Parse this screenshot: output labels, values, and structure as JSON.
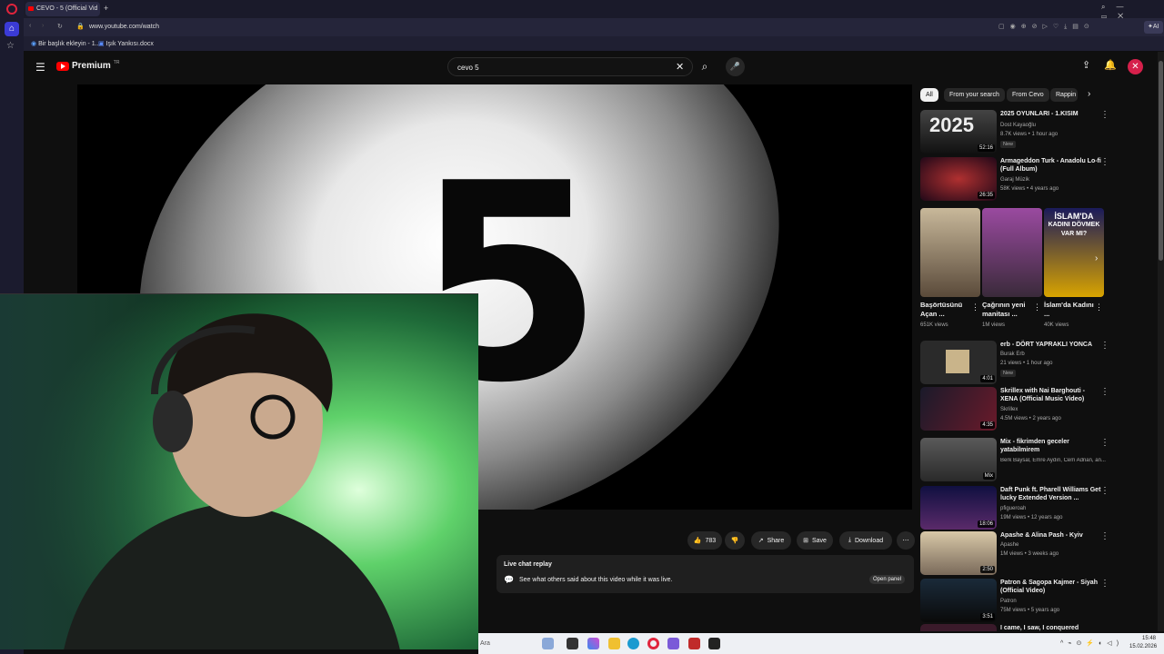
{
  "browser": {
    "tab_title": "CEVO - 5 (Official Vid",
    "url": "www.youtube.com/watch",
    "bookmarks": [
      "Bir başlık ekleyin - 1...",
      "Işık Yankısı.docx"
    ],
    "ai_label": "AI"
  },
  "youtube": {
    "logo": "Premium",
    "logo_sup": "TR",
    "search_value": "cevo 5",
    "video_digit": "5",
    "likes": "783",
    "share_label": "Share",
    "save_label": "Save",
    "download_label": "Download",
    "live_chat_title": "Live chat replay",
    "live_chat_desc": "See what others said about this video while it was live.",
    "open_panel_label": "Open panel",
    "chips": [
      "All",
      "From your search",
      "From Cevo",
      "Rappin"
    ]
  },
  "recommendations": [
    {
      "title": "2025 OYUNLARI - 1.KISIM",
      "channel": "Dost Kayaoğlu",
      "meta": "8.7K views • 1 hour ago",
      "duration": "52:16",
      "new": "New",
      "thumb_text": "2025"
    },
    {
      "title": "Armageddon Turk - Anadolu Lo-fi (Full Album)",
      "channel": "Garaj Müzik",
      "meta": "58K views • 4 years ago",
      "duration": "26:35",
      "new": ""
    },
    {
      "title": "erb - DÖRT YAPRAKLI YONCA",
      "channel": "Burak Erb",
      "meta": "21 views • 1 hour ago",
      "duration": "4:01",
      "new": "New"
    },
    {
      "title": "Skrillex with Nai Barghouti - XENA (Official Music Video)",
      "channel": "Skrillex",
      "meta": "4.5M views • 2 years ago",
      "duration": "4:35",
      "new": ""
    },
    {
      "title": "Mix - fikrimden geceler yatabilmirem",
      "channel": "Berk Baysal, Emre Aydın, Cem Adrian, an...",
      "meta": "",
      "duration": "Mix",
      "new": ""
    },
    {
      "title": "Daft Punk ft. Pharell Williams Get lucky Extended Version ...",
      "channel": "pfigueroah",
      "meta": "19M views • 12 years ago",
      "duration": "18:06",
      "new": ""
    },
    {
      "title": "Apashe & Alina Pash - Kyiv",
      "channel": "Apashe",
      "meta": "1M views • 3 weeks ago",
      "duration": "2:50",
      "new": ""
    },
    {
      "title": "Patron & Sagopa Kajmer - Siyah (Official Video)",
      "channel": "Patron",
      "meta": "75M views • 5 years ago",
      "duration": "3:51",
      "new": ""
    },
    {
      "title": "I came, I saw, I conquered",
      "channel": "",
      "meta": "",
      "duration": "",
      "new": ""
    }
  ],
  "shorts": [
    {
      "title": "Başörtüsünü Açan ...",
      "views": "651K views"
    },
    {
      "title": "Çağrının yeni manitası ...",
      "views": "1M views"
    },
    {
      "title": "İslam'da Kadını ...",
      "views": "40K views"
    }
  ],
  "shorts_overlay": {
    "line1": "İSLAM'DA",
    "line2": "KADINI DÖVMEK",
    "line3": "VAR MI?"
  },
  "taskbar": {
    "search_placeholder": "Ara",
    "time": "15:48",
    "date": "15.02.2026"
  }
}
